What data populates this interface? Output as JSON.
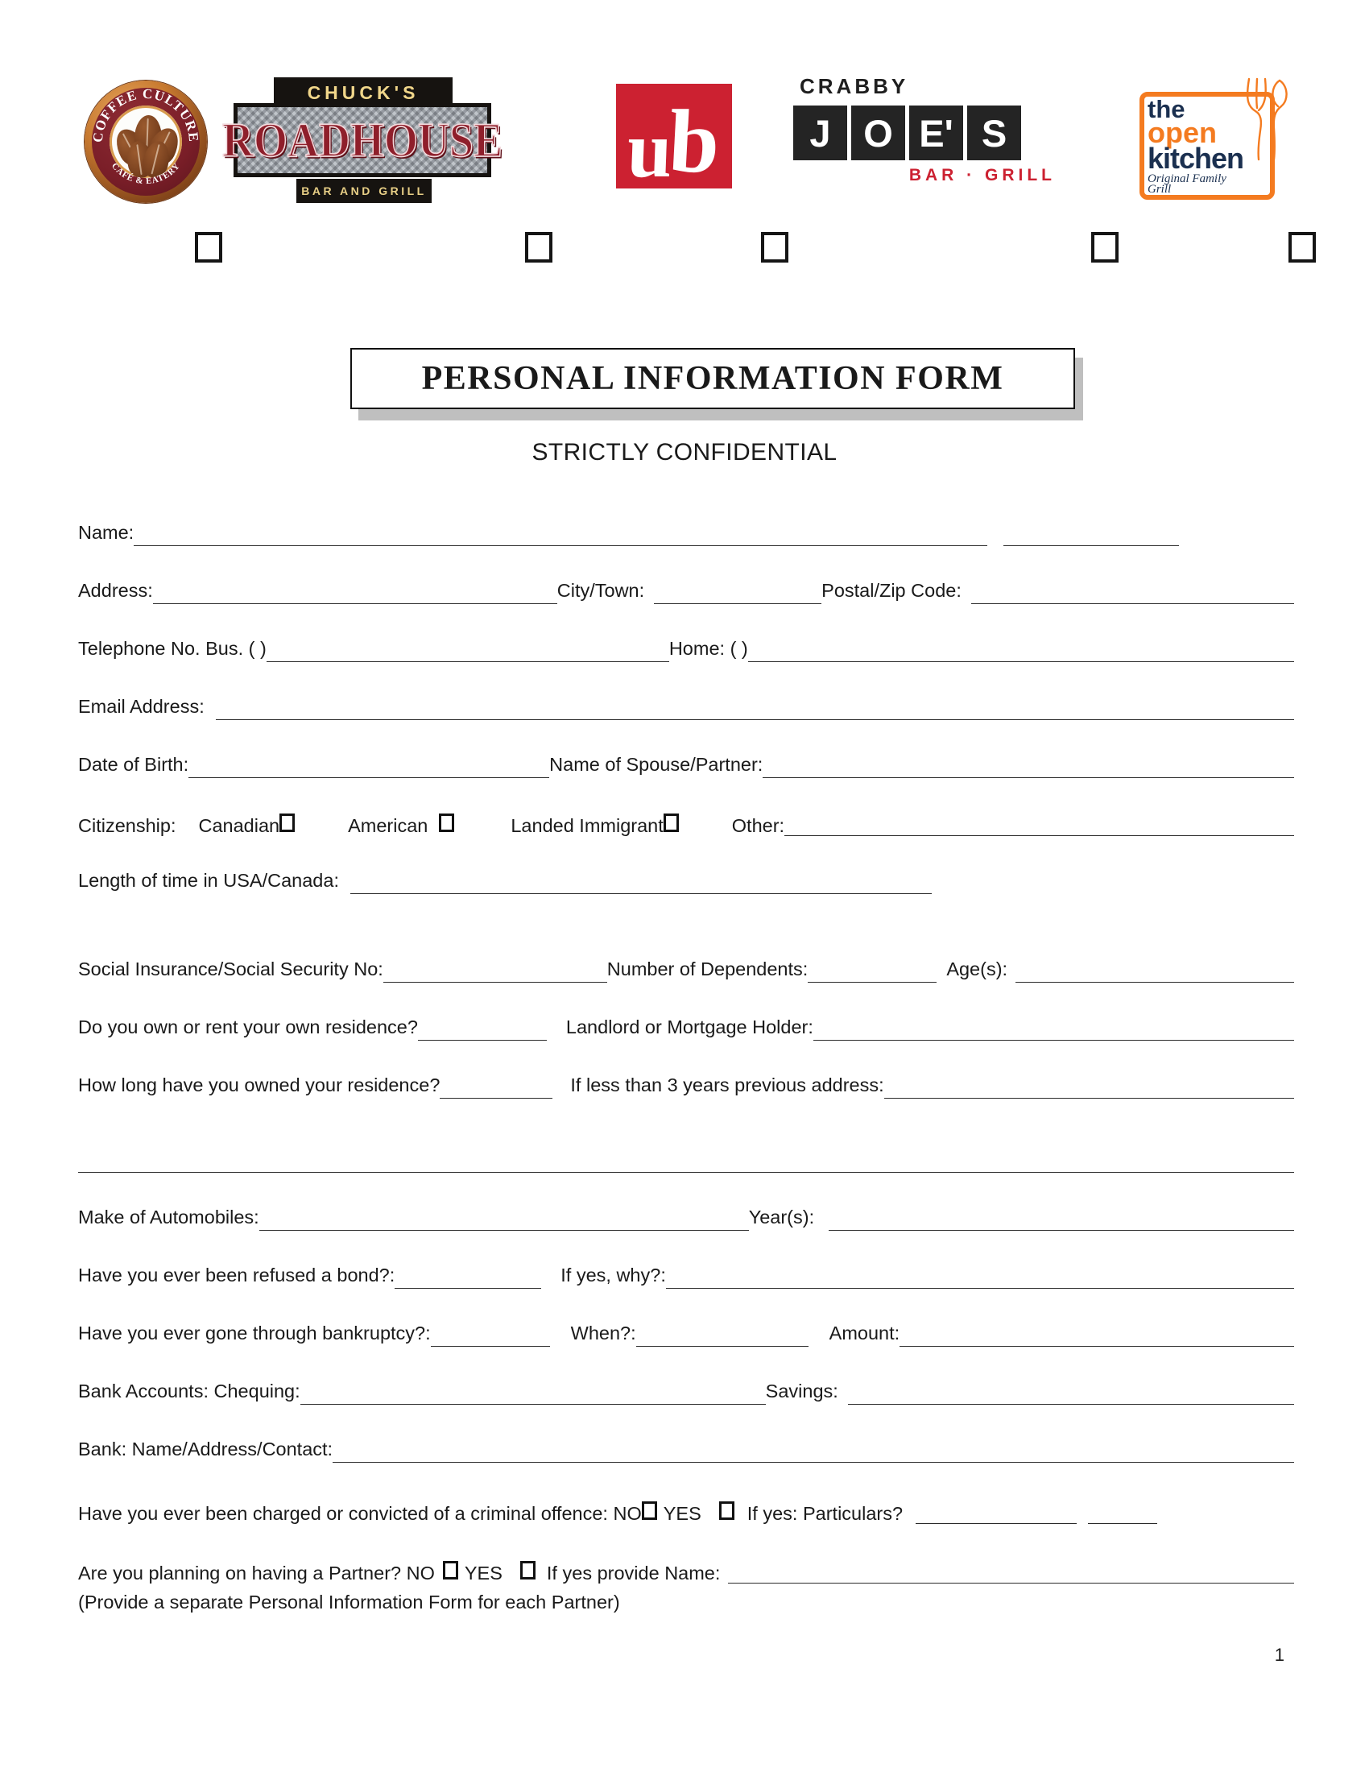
{
  "brand_logos": [
    {
      "name": "coffee-culture",
      "top_text": "COFFEE CULTURE",
      "bottom_text": "CAFÉ & EATERY"
    },
    {
      "name": "chucks-roadhouse",
      "top_text": "CHUCK'S",
      "main_text": "ROADHOUSE",
      "bottom_text": "BAR AND GRILL"
    },
    {
      "name": "ub",
      "main_text": "ub"
    },
    {
      "name": "crabby-joes",
      "top_text": "CRABBY",
      "tiles": [
        "J",
        "O",
        "E'",
        "S"
      ],
      "bottom_text": "BAR · GRILL"
    },
    {
      "name": "the-open-kitchen",
      "line1": "the",
      "line2": "open",
      "line3": "kitchen",
      "tagline": "Original Family Grill"
    }
  ],
  "header": {
    "title": "PERSONAL INFORMATION FORM",
    "subtitle": "STRICTLY CONFIDENTIAL"
  },
  "fields": {
    "name": "Name:",
    "address": "Address:",
    "city_town": "City/Town:",
    "postal_zip": "Postal/Zip Code:",
    "telephone_bus": "Telephone No. Bus. (      )",
    "home": "Home: (      )",
    "email": "Email Address:",
    "dob": "Date of Birth:",
    "spouse": "Name of Spouse/Partner:",
    "citizenship": "Citizenship:",
    "canadian": "Canadian",
    "american": "American",
    "landed_immigrant": "Landed Immigrant",
    "other": "Other:",
    "length_of_time": "Length of time in USA/Canada:",
    "sin_ssn": "Social Insurance/Social Security No:",
    "dependents": "Number of Dependents:",
    "ages": "Age(s):",
    "own_or_rent": "Do you own or rent your own residence?",
    "landlord": "Landlord or Mortgage Holder:",
    "how_long_owned": "How long have you owned your residence?",
    "previous_address": "If less than 3 years previous address:",
    "automobiles": "Make of Automobiles:",
    "years": "Year(s):",
    "refused_bond": "Have you ever been refused a bond?:",
    "if_yes_why": "If yes, why?:",
    "bankruptcy": "Have you ever gone through bankruptcy?:",
    "when": "When?:",
    "amount": "Amount:",
    "bank_chequing": "Bank Accounts: Chequing:",
    "savings": "Savings:",
    "bank_contact": "Bank: Name/Address/Contact:",
    "criminal_offence": "Have you ever been charged or convicted of a criminal offence: NO",
    "criminal_yes": "YES",
    "if_yes_particulars": "If yes:  Particulars?",
    "partner_question": "Are you planning on having a Partner? NO",
    "partner_yes": "YES",
    "partner_name": "If  yes provide Name:",
    "partner_note": "(Provide a separate Personal Information Form for each Partner)"
  },
  "footer": {
    "page_number": "1"
  },
  "colors": {
    "brand_red": "#cc2131",
    "roadhouse_red": "#8f1f2b",
    "gold": "#f0d68a",
    "orange": "#f47b20",
    "navy": "#1b3050",
    "rule": "#2b2b2b"
  }
}
